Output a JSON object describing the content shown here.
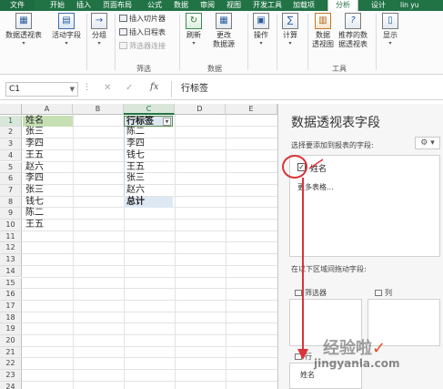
{
  "tabs": {
    "file": "文件",
    "items": [
      "开始",
      "插入",
      "页面布局",
      "公式",
      "数据",
      "审阅",
      "视图",
      "开发工具",
      "加载项",
      "分析",
      "设计"
    ],
    "user": "lin yu"
  },
  "ribbon": {
    "pivot_table": "数据透视表",
    "active_field": "活动字段",
    "group": "分组",
    "insert_slicer": "插入切片器",
    "insert_timeline": "插入日程表",
    "filter_connections": "筛选器连接",
    "refresh": "刷新",
    "change_source": "更改",
    "change_source_2": "数据源",
    "actions": "操作",
    "calculations": "计算",
    "pivot_chart": "数据",
    "pivot_chart_2": "透视图",
    "recommended": "推荐的数",
    "recommended_2": "据透视表",
    "show": "显示",
    "group_filter_label": "筛选",
    "group_data_label": "数据",
    "group_tools_label": "工具"
  },
  "formula_bar": {
    "name_box": "C1",
    "fx": "fx",
    "value": "行标签"
  },
  "grid": {
    "columns": [
      "A",
      "B",
      "C",
      "D",
      "E"
    ],
    "rows": [
      "1",
      "2",
      "3",
      "4",
      "5",
      "6",
      "7",
      "8",
      "9",
      "10",
      "11",
      "12",
      "13",
      "14",
      "15",
      "16",
      "17",
      "18",
      "19",
      "20",
      "21",
      "22",
      "23",
      "24"
    ],
    "col_a": [
      "姓名",
      "张三",
      "李四",
      "王五",
      "赵六",
      "李四",
      "张三",
      "钱七",
      "陈二",
      "王五"
    ],
    "pivot_header": "行标签",
    "pivot_items": [
      "陈二",
      "李四",
      "钱七",
      "王五",
      "张三",
      "赵六"
    ],
    "pivot_total": "总计"
  },
  "pane": {
    "title": "数据透视表字段",
    "subtitle": "选择要添加到报表的字段:",
    "field": "姓名",
    "more_tables": "更多表格...",
    "areas_label": "在以下区域间拖动字段:",
    "filters": "筛选器",
    "columns": "列",
    "rows": "行",
    "row_item": "姓名"
  },
  "watermark": {
    "text": "经验啦",
    "tick": "✓",
    "url": "jingyanla.com"
  },
  "colors": {
    "excel_green": "#217346",
    "annotation_red": "#d9343a",
    "pivot_blue": "#dde8f3",
    "header_green": "#c6e0b4"
  }
}
